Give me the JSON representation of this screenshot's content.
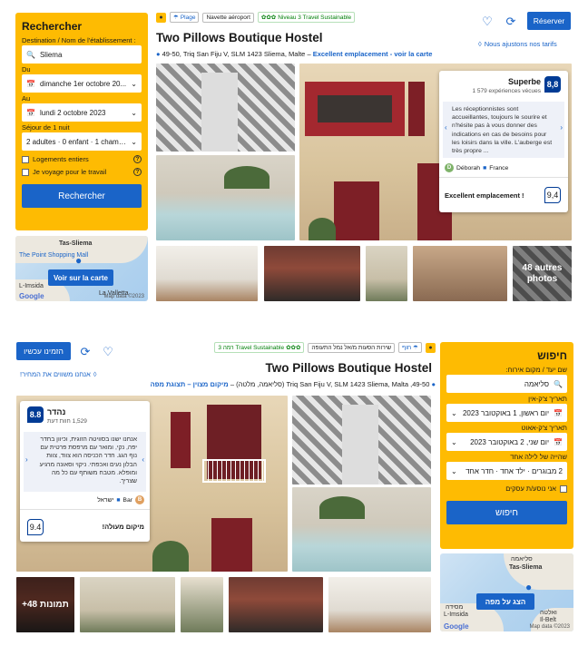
{
  "colors": {
    "accent": "#1a64c8",
    "search_bg": "#febb02",
    "score_bg": "#003b95",
    "sustainable": "#008009"
  },
  "fr": {
    "search": {
      "title": "Rechercher",
      "destination_label": "Destination / Nom de l'établissement :",
      "destination_value": "Sliema",
      "checkin_label": "Du",
      "checkin_value": "dimanche 1er octobre 20...",
      "checkout_label": "Au",
      "checkout_value": "lundi 2 octobre 2023",
      "stay_label": "Séjour de 1 nuit",
      "guests_value": "2 adultes · 0 enfant · 1 chambre",
      "option1": "Logements entiers",
      "option2": "Je voyage pour le travail",
      "button": "Rechercher"
    },
    "map": {
      "city": "Tas-Sliema",
      "poi": "The Point Shopping Mall",
      "area": "L-Imsida",
      "button": "Voir sur la carte",
      "credit": "Map data ©2023",
      "logo": "Google",
      "la_valletta": "La Valletta"
    },
    "tags": {
      "beach": "Plage",
      "shuttle": "Navette aéroport",
      "sustainable": "Niveau 3 Travel Sustainable"
    },
    "hotel_name": "Two Pillows Boutique Hostel",
    "address": "49-50, Triq San Fiju V, SLM 1423 Sliema, Malte",
    "location_link": "Excellent emplacement - voir la carte",
    "reserve": "Réserver",
    "price_match": "Nous ajustons nos tarifs",
    "review": {
      "rating_word": "Superbe",
      "count": "1 579 expériences vécues",
      "score": "8,8",
      "quote": "Les réceptionnistes sont accueillantes, toujours le sourire et n'hésite pas à vous donner des indications en cas de besoins pour les loisirs dans la ville. L'auberge est très propre ...",
      "reviewer": "Déborah",
      "country": "France",
      "avatar": "D",
      "location": "Excellent emplacement !",
      "location_score": "9,4"
    },
    "more_photos": "48 autres photos"
  },
  "he": {
    "search": {
      "title": "חיפוש",
      "destination_label": "שם יעד / מקום אירוח:",
      "destination_value": "סליאמה",
      "checkin_label": "תאריך צ'ק-אין",
      "checkin_value": "יום ראשון, 1 באוקטובר 2023",
      "checkout_label": "תאריך צ'ק-אאוט",
      "checkout_value": "יום שני, 2 באוקטובר 2023",
      "stay_label": "שהייה של לילה אחד",
      "guests_value": "2 מבוגרים · ילד אחד · חדר אחד",
      "option1": "אני נוסע/ת עסקים",
      "button": "חיפוש"
    },
    "map": {
      "city": "Tas-Sliema",
      "city_he": "סליאמה",
      "area": "L-Imsida",
      "area_he": "מסידה",
      "city2": "Il-Belt",
      "city2_he": "ואלטה",
      "button": "הצג על מפה",
      "credit": "Map data ©2023",
      "logo": "Google"
    },
    "tags": {
      "level": "Travel Sustainable רמה 3",
      "shuttle": "שירות הסעות מ/אל נמל התעופה",
      "beach": "חוף"
    },
    "hotel_name": "Two Pillows Boutique Hostel",
    "address": "49-50, Triq San Fiju V, SLM 1423 Sliema, Malta (סליאמה, מלטה)",
    "location_link": "מיקום מצוין – תצוגת מפה",
    "reserve": "הזמינו עכשיו",
    "price_match": "אנחנו משווים את המחיר!",
    "review": {
      "rating_word": "נהדר",
      "count": "1,529 חוות דעת",
      "score": "8.8",
      "quote": "אנחנו ישנו בסוויטה הזוגית, וכיוון בחדר יפה, נקי, ומואר עם מרפסת פרטית עם נוף הגג. חדר הכניסה הוא צווד, צוות הבלון נעים ואכפתי. ניקוי וסאונה מרגיע ומופלא. מטבח משותף עם כל מה שצריך.",
      "reviewer": "Bar",
      "country": "ישראל",
      "avatar": "B",
      "location": "מיקום מעולה!",
      "location_score": "9.4"
    },
    "more_photos": "+48 תמונות"
  }
}
